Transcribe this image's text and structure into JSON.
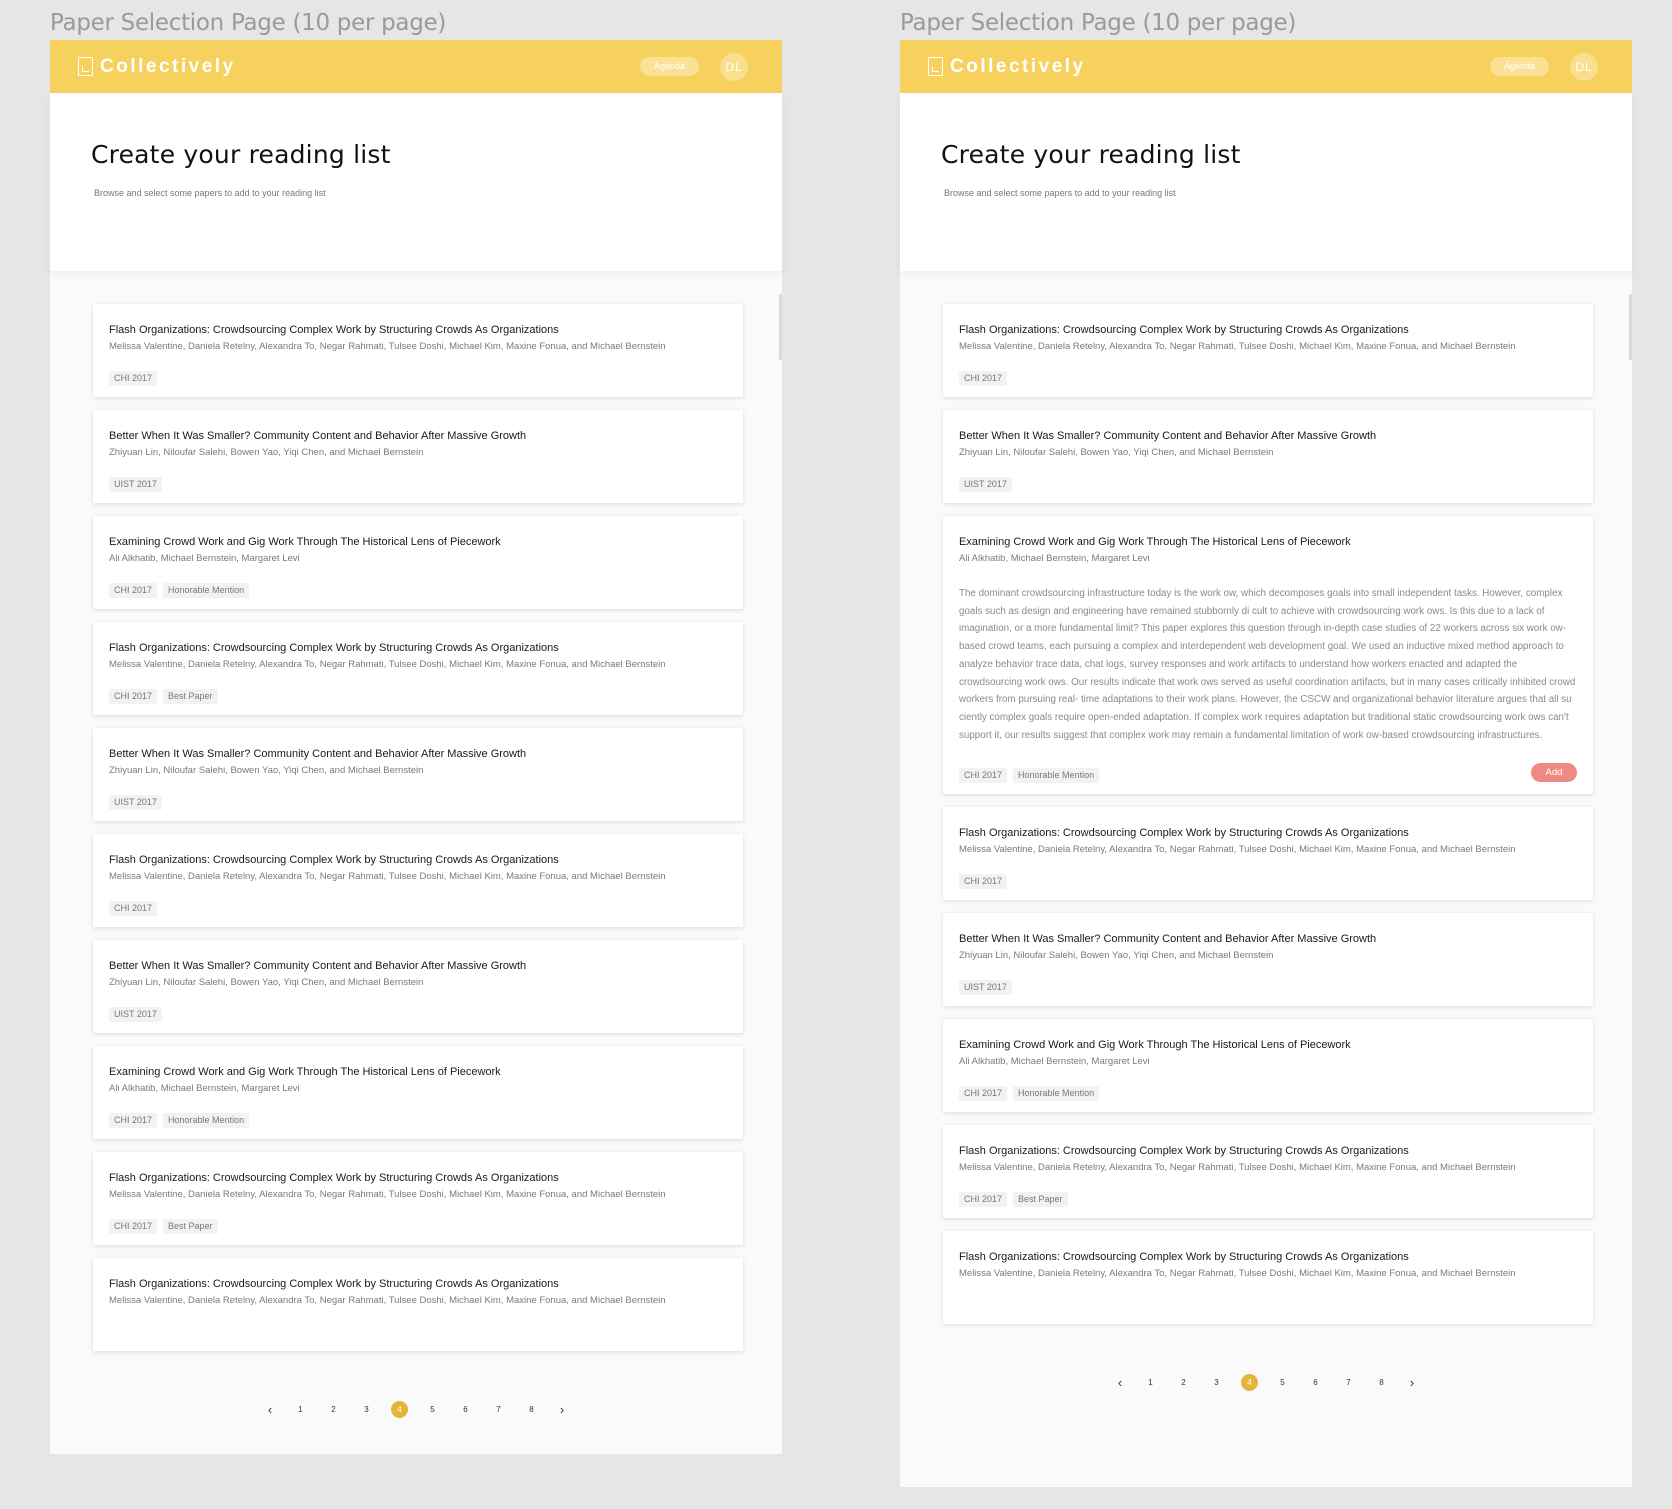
{
  "artboards": [
    {
      "label": "Paper Selection Page (10 per page)",
      "header": {
        "logo": "Collectively",
        "agenda": "Agenda",
        "avatar": "DL"
      },
      "hero": {
        "title": "Create your reading list",
        "subtitle": "Browse and select some papers to add to your reading list"
      },
      "pagination": {
        "prev": "‹",
        "next": "›",
        "pages": [
          "1",
          "2",
          "3",
          "4",
          "5",
          "6",
          "7",
          "8"
        ],
        "active": "4"
      },
      "papers": [
        {
          "title": "Flash Organizations: Crowdsourcing Complex Work by Structuring Crowds As Organizations",
          "authors": "Melissa Valentine, Daniela Retelny, Alexandra To, Negar Rahmati, Tulsee Doshi, Michael Kim, Maxine Fonua, and Michael Bernstein",
          "tags": [
            "CHI 2017"
          ]
        },
        {
          "title": "Better When It Was Smaller? Community Content and Behavior After Massive Growth",
          "authors": "Zhiyuan Lin, Niloufar Salehi, Bowen Yao, Yiqi Chen, and Michael Bernstein",
          "tags": [
            "UIST 2017"
          ]
        },
        {
          "title": "Examining Crowd Work and Gig Work Through The Historical Lens of Piecework",
          "authors": "Ali Alkhatib, Michael Bernstein, Margaret Levi",
          "tags": [
            "CHI 2017",
            "Honorable Mention"
          ]
        },
        {
          "title": "Flash Organizations: Crowdsourcing Complex Work by Structuring Crowds As Organizations",
          "authors": "Melissa Valentine, Daniela Retelny, Alexandra To, Negar Rahmati, Tulsee Doshi, Michael Kim, Maxine Fonua, and Michael Bernstein",
          "tags": [
            "CHI 2017",
            "Best Paper"
          ]
        },
        {
          "title": "Better When It Was Smaller? Community Content and Behavior After Massive Growth",
          "authors": "Zhiyuan Lin, Niloufar Salehi, Bowen Yao, Yiqi Chen, and Michael Bernstein",
          "tags": [
            "UIST 2017"
          ]
        },
        {
          "title": "Flash Organizations: Crowdsourcing Complex Work by Structuring Crowds As Organizations",
          "authors": "Melissa Valentine, Daniela Retelny, Alexandra To, Negar Rahmati, Tulsee Doshi, Michael Kim, Maxine Fonua, and Michael Bernstein",
          "tags": [
            "CHI 2017"
          ]
        },
        {
          "title": "Better When It Was Smaller? Community Content and Behavior After Massive Growth",
          "authors": "Zhiyuan Lin, Niloufar Salehi, Bowen Yao, Yiqi Chen, and Michael Bernstein",
          "tags": [
            "UIST 2017"
          ]
        },
        {
          "title": "Examining Crowd Work and Gig Work Through The Historical Lens of Piecework",
          "authors": "Ali Alkhatib, Michael Bernstein, Margaret Levi",
          "tags": [
            "CHI 2017",
            "Honorable Mention"
          ]
        },
        {
          "title": "Flash Organizations: Crowdsourcing Complex Work by Structuring Crowds As Organizations",
          "authors": "Melissa Valentine, Daniela Retelny, Alexandra To, Negar Rahmati, Tulsee Doshi, Michael Kim, Maxine Fonua, and Michael Bernstein",
          "tags": [
            "CHI 2017",
            "Best Paper"
          ]
        },
        {
          "title": "Flash Organizations: Crowdsourcing Complex Work by Structuring Crowds As Organizations",
          "authors": "Melissa Valentine, Daniela Retelny, Alexandra To, Negar Rahmati, Tulsee Doshi, Michael Kim, Maxine Fonua, and Michael Bernstein",
          "tags": []
        }
      ]
    },
    {
      "label": "Paper Selection Page (10 per page)",
      "header": {
        "logo": "Collectively",
        "agenda": "Agenda",
        "avatar": "DL"
      },
      "hero": {
        "title": "Create your reading list",
        "subtitle": "Browse and select some papers to add to your reading list"
      },
      "pagination": {
        "prev": "‹",
        "next": "›",
        "pages": [
          "1",
          "2",
          "3",
          "4",
          "5",
          "6",
          "7",
          "8"
        ],
        "active": "4"
      },
      "papers": [
        {
          "title": "Flash Organizations: Crowdsourcing Complex Work by Structuring Crowds As Organizations",
          "authors": "Melissa Valentine, Daniela Retelny, Alexandra To, Negar Rahmati, Tulsee Doshi, Michael Kim, Maxine Fonua, and Michael Bernstein",
          "tags": [
            "CHI 2017"
          ]
        },
        {
          "title": "Better When It Was Smaller? Community Content and Behavior After Massive Growth",
          "authors": "Zhiyuan Lin, Niloufar Salehi, Bowen Yao, Yiqi Chen, and Michael Bernstein",
          "tags": [
            "UIST 2017"
          ]
        },
        {
          "title": "Examining Crowd Work and Gig Work Through The Historical Lens of Piecework",
          "authors": "Ali Alkhatib, Michael Bernstein, Margaret Levi",
          "tags": [
            "CHI 2017",
            "Honorable Mention"
          ],
          "abstract": "The dominant crowdsourcing infrastructure today is the work ow, which decomposes goals into small independent tasks. However, complex goals such as design and engineering have remained stubbornly di cult to achieve with crowdsourcing work ows. Is this due to a lack of imagination, or a more fundamental limit? This paper explores this question through in-depth case studies of 22 workers across six work ow-based crowd teams, each pursuing a complex and interdependent web development goal. We used an inductive mixed method approach to analyze behavior trace data, chat logs, survey responses and work artifacts to understand how workers enacted and adapted the crowdsourcing work ows. Our results indicate that work ows served as useful coordination artifacts, but in many cases critically inhibited crowd workers from pursuing real- time adaptations to their work plans. However, the CSCW and organizational behavior literature argues that all su ciently complex goals require open-ended adaptation. If complex work requires adaptation but traditional static crowdsourcing work ows can't support it, our results suggest that complex work may remain a fundamental limitation of work ow-based crowdsourcing infrastructures.",
          "action": "Add"
        },
        {
          "title": "Flash Organizations: Crowdsourcing Complex Work by Structuring Crowds As Organizations",
          "authors": "Melissa Valentine, Daniela Retelny, Alexandra To, Negar Rahmati, Tulsee Doshi, Michael Kim, Maxine Fonua, and Michael Bernstein",
          "tags": [
            "CHI 2017"
          ]
        },
        {
          "title": "Better When It Was Smaller? Community Content and Behavior After Massive Growth",
          "authors": "Zhiyuan Lin, Niloufar Salehi, Bowen Yao, Yiqi Chen, and Michael Bernstein",
          "tags": [
            "UIST 2017"
          ]
        },
        {
          "title": "Examining Crowd Work and Gig Work Through The Historical Lens of Piecework",
          "authors": "Ali Alkhatib, Michael Bernstein, Margaret Levi",
          "tags": [
            "CHI 2017",
            "Honorable Mention"
          ]
        },
        {
          "title": "Flash Organizations: Crowdsourcing Complex Work by Structuring Crowds As Organizations",
          "authors": "Melissa Valentine, Daniela Retelny, Alexandra To, Negar Rahmati, Tulsee Doshi, Michael Kim, Maxine Fonua, and Michael Bernstein",
          "tags": [
            "CHI 2017",
            "Best Paper"
          ]
        },
        {
          "title": "Flash Organizations: Crowdsourcing Complex Work by Structuring Crowds As Organizations",
          "authors": "Melissa Valentine, Daniela Retelny, Alexandra To, Negar Rahmati, Tulsee Doshi, Michael Kim, Maxine Fonua, and Michael Bernstein",
          "tags": []
        }
      ]
    }
  ]
}
